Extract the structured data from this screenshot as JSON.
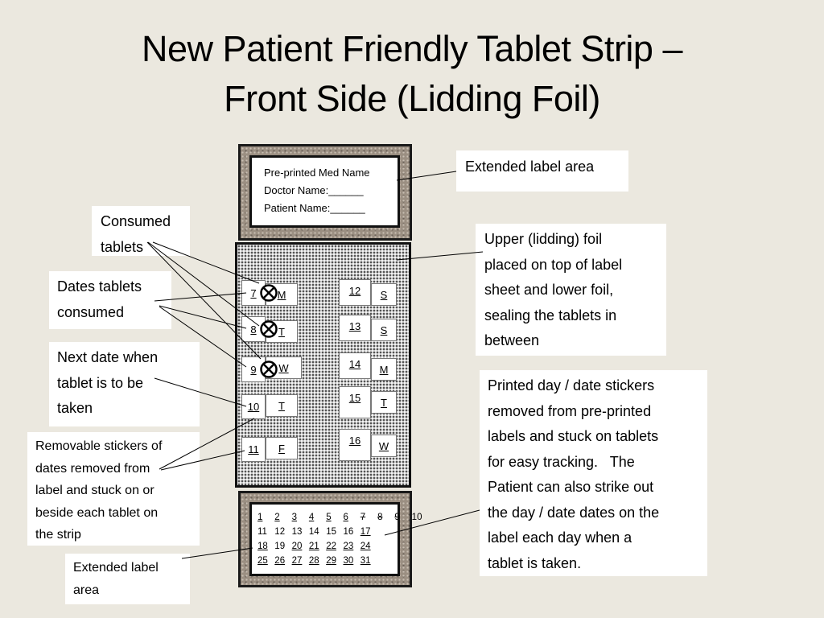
{
  "title": {
    "line1": "New Patient Friendly Tablet Strip –",
    "line2": "Front Side (Lidding Foil)"
  },
  "callouts": {
    "extended_label_top": "Extended label area",
    "upper_foil": [
      "Upper (lidding) foil",
      "placed on top of label",
      "sheet and lower foil,",
      "sealing the tablets in",
      "between"
    ],
    "printed_stickers": [
      "Printed day / date stickers",
      "removed from pre-printed",
      "labels and stuck on tablets",
      "for easy tracking.   The",
      "Patient can also strike out",
      "the day / date dates on the",
      "label each day when a",
      "tablet is taken."
    ],
    "consumed_tablets": [
      "Consumed",
      "tablets"
    ],
    "dates_consumed": [
      "Dates tablets",
      "consumed"
    ],
    "next_date": [
      "Next date when",
      "tablet is to be",
      "taken"
    ],
    "removable_stickers": [
      "Removable stickers of",
      "dates removed from",
      "label and stuck on or",
      "beside each tablet on",
      "the strip"
    ],
    "extended_label_bottom": [
      "Extended label",
      "area"
    ]
  },
  "top_label": {
    "med_name": "Pre-printed Med Name",
    "doctor": "Doctor Name:______",
    "patient": "Patient Name:______"
  },
  "tablets_left": [
    {
      "date": "7",
      "day": "M",
      "consumed": true
    },
    {
      "date": "8",
      "day": "T",
      "consumed": true
    },
    {
      "date": "9",
      "day": "W",
      "consumed": true
    },
    {
      "date": "10",
      "day": "T",
      "consumed": false
    },
    {
      "date": "11",
      "day": "F",
      "consumed": false
    }
  ],
  "tablets_right": [
    {
      "date": "12",
      "day": "S"
    },
    {
      "date": "13",
      "day": "S"
    },
    {
      "date": "14",
      "day": "M"
    },
    {
      "date": "15",
      "day": "T"
    },
    {
      "date": "16",
      "day": "W"
    }
  ],
  "calendar": {
    "rows": [
      [
        {
          "n": "1",
          "style": "u"
        },
        {
          "n": "2",
          "style": "u"
        },
        {
          "n": "3",
          "style": "u"
        },
        {
          "n": "4",
          "style": "u"
        },
        {
          "n": "5",
          "style": "u"
        },
        {
          "n": "6",
          "style": "u"
        },
        {
          "n": "7",
          "style": "s"
        },
        {
          "n": "8",
          "style": "s"
        },
        {
          "n": "9",
          "style": "s"
        },
        {
          "n": "10",
          "style": ""
        }
      ],
      [
        {
          "n": "11",
          "style": ""
        },
        {
          "n": "12",
          "style": ""
        },
        {
          "n": "13",
          "style": ""
        },
        {
          "n": "14",
          "style": ""
        },
        {
          "n": "15",
          "style": ""
        },
        {
          "n": "16",
          "style": ""
        },
        {
          "n": "17",
          "style": "u"
        }
      ],
      [
        {
          "n": "18",
          "style": "u"
        },
        {
          "n": "19",
          "style": ""
        },
        {
          "n": "20",
          "style": "u"
        },
        {
          "n": "21",
          "style": "u"
        },
        {
          "n": "22",
          "style": "u"
        },
        {
          "n": "23",
          "style": "u"
        },
        {
          "n": "24",
          "style": "u"
        }
      ],
      [
        {
          "n": "25",
          "style": "u"
        },
        {
          "n": "26",
          "style": "u"
        },
        {
          "n": "27",
          "style": "u"
        },
        {
          "n": "28",
          "style": "u"
        },
        {
          "n": "29",
          "style": "u"
        },
        {
          "n": "30",
          "style": "u"
        },
        {
          "n": "31",
          "style": "u"
        }
      ]
    ]
  }
}
